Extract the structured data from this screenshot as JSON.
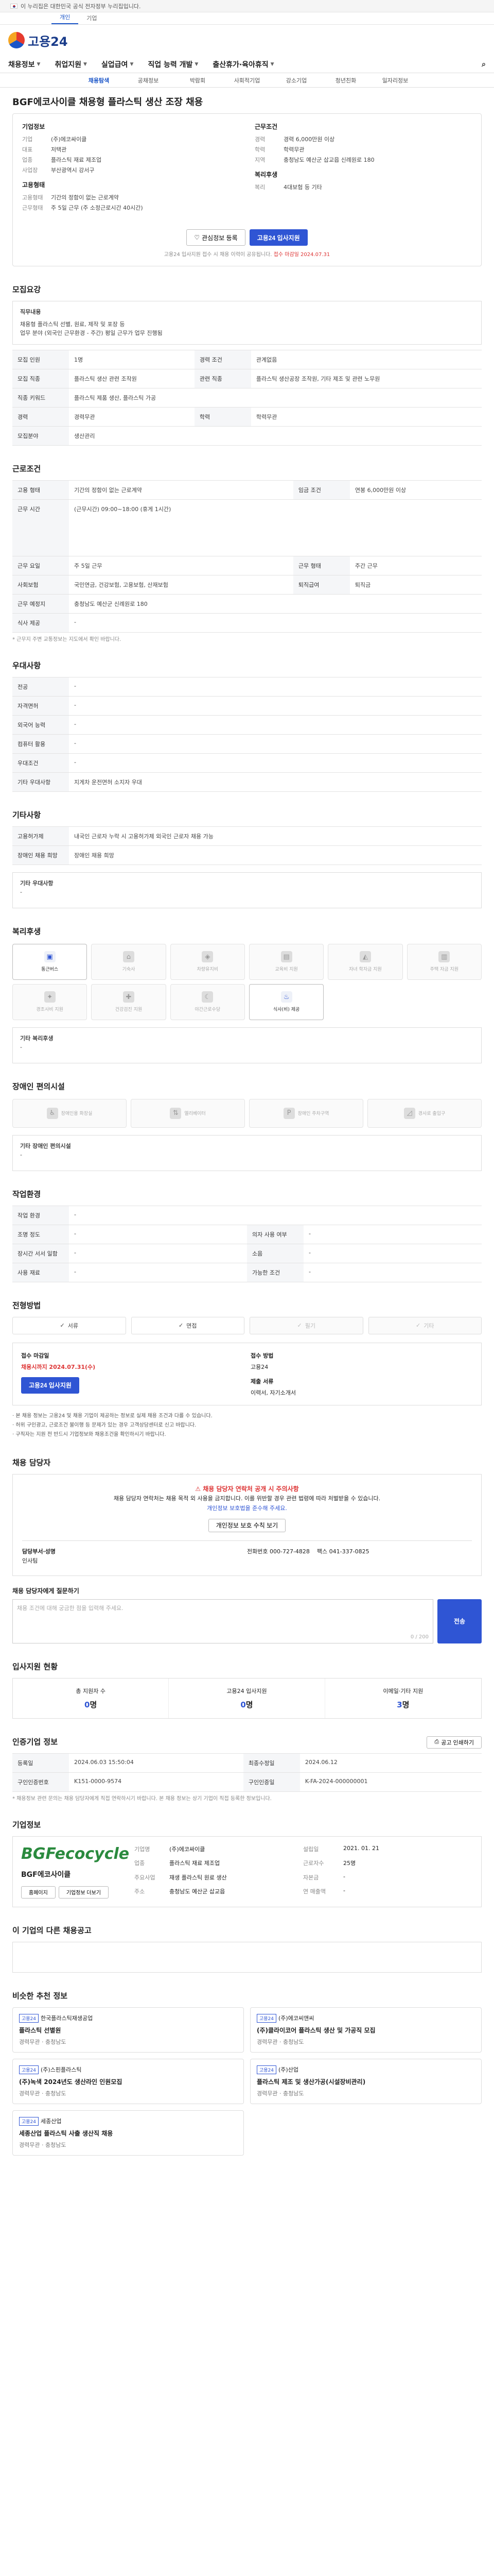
{
  "gov": {
    "notice": "이 누리집은 대한민국 공식 전자정부 누리집입니다."
  },
  "userTabs": [
    "개인",
    "기업"
  ],
  "brand": {
    "name": "고용24"
  },
  "gnb": [
    "채용정보",
    "취업지원",
    "실업급여",
    "직업 능력 개발",
    "출산휴가·육아휴직"
  ],
  "lnb": [
    "채용탐색",
    "공채정보",
    "박람회",
    "사회적기업",
    "강소기업",
    "청년친화",
    "일자리정보"
  ],
  "job": {
    "title": "BGF에코사이클 채용형 플라스틱 생산 조장 채용",
    "company_label": "기업정보",
    "company": [
      {
        "k": "기업",
        "v": "(주)에코싸이클"
      },
      {
        "k": "대표",
        "v": "저택관"
      },
      {
        "k": "업종",
        "v": "플라스틱 재료 제조업"
      },
      {
        "k": "사업장",
        "v": "부산광역시 강서구"
      }
    ],
    "cond_label": "근무조건",
    "cond": [
      {
        "k": "경력",
        "v": "경력 6,000만원 이상"
      },
      {
        "k": "학력",
        "v": "학력무관"
      },
      {
        "k": "지역",
        "v": "충청남도 예산군 삽교읍 신례원로 180"
      }
    ],
    "form_label": "고용형태",
    "form": [
      {
        "k": "고용형태",
        "v": "기간의 정함이 없는 근로계약"
      },
      {
        "k": "근무형태",
        "v": "주 5일 근무 (주 소정근로시간 40시간)"
      }
    ],
    "welfare_label": "복리후생",
    "welfare": [
      {
        "k": "복리",
        "v": "4대보험 등 기타"
      }
    ]
  },
  "buttons": {
    "scrap": "관심정보 등록",
    "apply": "고용24 입사지원"
  },
  "apply_note": "고용24 입사지원 접수 시 채용 이력이 공유됩니다.",
  "apply_note_red": "접수 마감일 2024.07.31",
  "sections": {
    "recruit": "모집요강",
    "conditions": "근로조건",
    "welfare": "우대사항",
    "other": "기타사항",
    "benefits": "복리후생",
    "disability": "장애인 편의시설",
    "workplace": "작업환경",
    "process": "전형방법",
    "contact": "채용 담당자",
    "status": "입사지원 현황",
    "info": "인증기업 정보",
    "company": "기업정보",
    "similar": "이 기업의 다른 채용공고",
    "recommend": "비슷한 추천 정보"
  },
  "recruit": {
    "duty_label": "직무내용",
    "duty_text": "채용형 플라스틱 선별, 원료, 제작 및 포장 등\n업무 분야 (외국인 근무환경 - 주간) 평일 근무가 업무 진행됨",
    "rows": [
      {
        "k": "모집 인원",
        "v": "1명",
        "k2": "경력 조건",
        "v2": "관계없음"
      },
      {
        "k": "모집 직종",
        "v": "플라스틱 생산 관련 조작원",
        "k2": "관련 직종",
        "v2": "플라스틱 생산공장 조작원, 기타 제조 및 관련 노무원"
      },
      {
        "k": "직종 키워드",
        "v": "플라스틱 제품 생산, 플라스틱 가공",
        "k2": "",
        "v2": ""
      },
      {
        "k": "경력",
        "v": "경력무관",
        "k2": "학력",
        "v2": "학력무관"
      },
      {
        "k": "모집분야",
        "v": "생산관리",
        "k2": "",
        "v2": ""
      }
    ]
  },
  "conditions": {
    "rows": [
      {
        "k": "고용 형태",
        "v": "기간의 정함이 없는 근로계약",
        "k2": "임금 조건",
        "v2": "연봉 6,000만원 이상"
      },
      {
        "k": "근무 시간",
        "v": "(근무시간) 09:00~18:00 (휴게 1시간)",
        "k2": "",
        "v2": ""
      },
      {
        "k": "근무 요일",
        "v": "주 5일 근무",
        "k2": "근무 형태",
        "v2": "주간 근무"
      },
      {
        "k": "사회보험",
        "v": "국민연금, 건강보험, 고용보험, 산재보험",
        "k2": "퇴직급여",
        "v2": "퇴직금"
      },
      {
        "k": "근무 예정지",
        "v": "충청남도 예산군 신례원로 180",
        "k2": "",
        "v2": ""
      },
      {
        "k": "식사 제공",
        "v": "-",
        "k2": "",
        "v2": ""
      }
    ],
    "hint": "* 근무지 주변 교통정보는 지도에서 확인 바랍니다."
  },
  "preference": {
    "rows": [
      {
        "k": "전공",
        "v": "-"
      },
      {
        "k": "자격면허",
        "v": "-"
      },
      {
        "k": "외국어 능력",
        "v": "-"
      },
      {
        "k": "컴퓨터 활용",
        "v": "-"
      },
      {
        "k": "우대조건",
        "v": "-"
      },
      {
        "k": "기타 우대사항",
        "v": "지게차 운전면허 소지자 우대"
      }
    ]
  },
  "other": {
    "rows": [
      {
        "k": "고용허가제",
        "v": "내국인 근로자 누락 시 고용허가제 외국인 근로자 채용 가능"
      },
      {
        "k": "장애인 채용 희망",
        "v": "장애인 채용 희망"
      }
    ],
    "extra_label": "기타 우대사항",
    "extra_value": "-"
  },
  "benefits": {
    "tiles": [
      {
        "name": "통근버스",
        "on": true
      },
      {
        "name": "기숙사",
        "on": false
      },
      {
        "name": "차량유지비",
        "on": false
      },
      {
        "name": "교육비 지원",
        "on": false
      },
      {
        "name": "자녀 학자금 지원",
        "on": false
      },
      {
        "name": "주택 자금 지원",
        "on": false
      },
      {
        "name": "경조사비 지원",
        "on": false
      },
      {
        "name": "건강검진 지원",
        "on": false
      },
      {
        "name": "야간근로수당",
        "on": false
      },
      {
        "name": "식사(비) 제공",
        "on": true
      }
    ],
    "extra_label": "기타 복리후생",
    "extra_value": "-"
  },
  "disability": {
    "tiles": [
      "장애인용 화장실",
      "엘리베이터",
      "장애인 주차구역",
      "경사로 출입구"
    ],
    "extra_label": "기타 장애인 편의시설",
    "extra_value": "-"
  },
  "workplace": {
    "rows": [
      {
        "k": "작업 환경",
        "v": "-",
        "k2": "",
        "v2": ""
      },
      {
        "k": "조명 정도",
        "v": "-",
        "k2": "의자 사용 여부",
        "v2": "-"
      },
      {
        "k": "장시간 서서 일함",
        "v": "-",
        "k2": "소음",
        "v2": "-"
      },
      {
        "k": "사용 재료",
        "v": "-",
        "k2": "가능한 조건",
        "v2": "-"
      }
    ]
  },
  "process": {
    "steps": [
      {
        "name": "서류",
        "on": true
      },
      {
        "name": "면접",
        "on": true
      },
      {
        "name": "필기",
        "on": false
      },
      {
        "name": "기타",
        "on": false
      }
    ],
    "apply_label": "접수 마감일",
    "apply_deadline": "채용시까지 2024.07.31(수)",
    "method_label": "접수 방법",
    "method_value": "고용24",
    "apply_button": "고용24 입사지원",
    "doc_label": "제출 서류",
    "doc_value": "이력서, 자기소개서",
    "notes": [
      "본 채용 정보는 고용24 및 채용 기업이 제공하는 정보로 실제 채용 조건과 다를 수 있습니다.",
      "허위 구인광고, 근로조건 불이행 등 문제가 있는 경우 고객상담센터로 신고 바랍니다.",
      "구직자는 지원 전 반드시 기업정보와 채용조건을 확인하시기 바랍니다."
    ]
  },
  "contact": {
    "warn": "채용 담당자 연락처 공개 시 주의사항",
    "body": "채용 담당자 연락처는 채용 목적 외 사용을 금지합니다. 이를 위반할 경우 관련 법령에 따라 처벌받을 수 있습니다.",
    "blue": "개인정보 보호법을 준수해 주세요.",
    "button": "개인정보 보호 수칙 보기",
    "name_label": "담당부서·성명",
    "name_value": "인사팀",
    "phone_label": "전화번호",
    "phone_value": "000-727-4828",
    "fax_label": "팩스",
    "fax_value": "041-337-0825",
    "qna_label": "채용 담당자에게 질문하기",
    "qna_placeholder": "채용 조건에 대해 궁금한 점을 입력해 주세요.",
    "qna_count": "0 / 200",
    "qna_button": "전송"
  },
  "status": {
    "stats": [
      {
        "label": "총 지원자 수",
        "value": "0"
      },
      {
        "label": "고용24 입사지원",
        "value": "0"
      },
      {
        "label": "이메일·기타 지원",
        "value": "3"
      }
    ],
    "unit": "명"
  },
  "info": {
    "rows": [
      {
        "k": "등록일",
        "v": "2024.06.03 15:50:04",
        "k2": "최종수정일",
        "v2": "2024.06.12"
      },
      {
        "k": "구인인증번호",
        "v": "K151-0000-9574",
        "k2": "구인인증일",
        "v2": "K-FA-2024-000000001"
      }
    ],
    "print_button": "공고 인쇄하기",
    "note": "* 채용정보 관련 문의는 채용 담당자에게 직접 연락하시기 바랍니다. 본 채용 정보는 상기 기업이 직접 등록한 정보입니다."
  },
  "company": {
    "logo_text": "BGFecocycle",
    "logo_sub": "BGF에코사이클",
    "btn_home": "홈페이지",
    "btn_more": "기업정보 더보기",
    "rows": [
      {
        "k": "기업명",
        "v": "(주)에코싸이클",
        "k2": "설립일",
        "v2": "2021. 01. 21"
      },
      {
        "k": "업종",
        "v": "플라스틱 재료 제조업",
        "k2": "근로자수",
        "v2": "25명"
      },
      {
        "k": "주요사업",
        "v": "재생 플라스틱 원료 생산",
        "k2": "자본금",
        "v2": "-"
      },
      {
        "k": "주소",
        "v": "충청남도 예산군 삽교읍",
        "k2": "연 매출액",
        "v2": "-"
      }
    ]
  },
  "recommend": {
    "cards": [
      {
        "tag": "고용24",
        "company": "한국플라스틱재생공업",
        "title": "플라스틱 선별원",
        "meta": "경력무관 · 충청남도"
      },
      {
        "tag": "고용24",
        "company": "(주)에코씨앤씨",
        "title": "(주)클라이코어 플라스틱 생산 및 가공직 모집",
        "meta": "경력무관 · 충청남도"
      },
      {
        "tag": "고용24",
        "company": "(주)스핀플라스틱",
        "title": "(주)녹색 2024년도 생산라인 인원모집",
        "meta": "경력무관 · 충청남도"
      },
      {
        "tag": "고용24",
        "company": "(주)산업",
        "title": "플라스틱 제조 및 생산가공(시설장비관리)",
        "meta": "경력무관 · 충청남도"
      },
      {
        "tag": "고용24",
        "company": "세종산업",
        "title": "세종산업 플라스틱 사출 생산직 채용",
        "meta": "경력무관 · 충청남도"
      }
    ]
  }
}
